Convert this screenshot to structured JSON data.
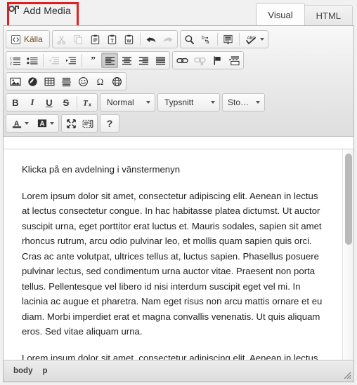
{
  "top_bar": {
    "add_media_label": "Add Media",
    "add_media_icon": "media-notes-icon",
    "highlight_color": "#e02020",
    "tabs": [
      {
        "label": "Visual",
        "active": true
      },
      {
        "label": "HTML",
        "active": false
      }
    ]
  },
  "toolbar": {
    "row1": {
      "source_button": {
        "label": "Källa",
        "icon": "source-code-icon"
      },
      "clipboard": [
        {
          "name": "cut-button",
          "icon": "scissors-icon",
          "disabled": true
        },
        {
          "name": "copy-button",
          "icon": "copy-icon",
          "disabled": true
        },
        {
          "name": "paste-button",
          "icon": "clipboard-icon",
          "disabled": false
        },
        {
          "name": "paste-as-plain-text-button",
          "icon": "clipboard-text-icon",
          "disabled": false
        },
        {
          "name": "paste-from-word-button",
          "icon": "clipboard-word-icon",
          "disabled": false
        },
        {
          "name": "undo-button",
          "icon": "undo-arrow-icon",
          "disabled": false
        },
        {
          "name": "redo-button",
          "icon": "redo-arrow-icon",
          "disabled": true
        }
      ],
      "editing": [
        {
          "name": "find-button",
          "icon": "magnifier-icon"
        },
        {
          "name": "replace-button",
          "icon": "replace-ba-icon"
        },
        {
          "name": "select-all-button",
          "icon": "select-all-icon"
        },
        {
          "name": "spellcheck-button",
          "icon": "abc-check-icon",
          "label": "ABC",
          "has_caret": true
        }
      ]
    },
    "row2": {
      "lists": [
        {
          "name": "numbered-list-button",
          "icon": "numbered-list-icon"
        },
        {
          "name": "bulleted-list-button",
          "icon": "bulleted-list-icon"
        },
        {
          "name": "decrease-indent-button",
          "icon": "outdent-icon",
          "disabled": true
        },
        {
          "name": "increase-indent-button",
          "icon": "indent-icon",
          "disabled": false
        },
        {
          "name": "blockquote-button",
          "icon": "quote-icon"
        },
        {
          "name": "align-left-button",
          "icon": "align-left-icon",
          "active": true
        },
        {
          "name": "align-center-button",
          "icon": "align-center-icon"
        },
        {
          "name": "align-right-button",
          "icon": "align-right-icon"
        },
        {
          "name": "align-justify-button",
          "icon": "align-justify-icon"
        }
      ],
      "links": [
        {
          "name": "insert-link-button",
          "icon": "link-icon"
        },
        {
          "name": "unlink-button",
          "icon": "unlink-icon",
          "disabled": true
        },
        {
          "name": "anchor-button",
          "icon": "flag-icon"
        },
        {
          "name": "page-break-button",
          "icon": "page-break-icon"
        }
      ]
    },
    "row3": {
      "insert": [
        {
          "name": "insert-image-button",
          "icon": "image-icon"
        },
        {
          "name": "insert-flash-button",
          "icon": "flash-icon"
        },
        {
          "name": "insert-table-button",
          "icon": "table-icon"
        },
        {
          "name": "horizontal-rule-button",
          "icon": "horizontal-rule-icon"
        },
        {
          "name": "insert-smiley-button",
          "icon": "smiley-icon"
        },
        {
          "name": "special-character-button",
          "icon": "omega-icon"
        },
        {
          "name": "iframe-button",
          "icon": "globe-icon"
        }
      ]
    },
    "row4": {
      "basic_styles": [
        {
          "name": "bold-button",
          "icon": "bold-icon",
          "label": "B"
        },
        {
          "name": "italic-button",
          "icon": "italic-icon",
          "label": "I"
        },
        {
          "name": "underline-button",
          "icon": "underline-icon",
          "label": "U"
        },
        {
          "name": "strikethrough-button",
          "icon": "strikethrough-icon",
          "label": "S"
        },
        {
          "name": "remove-format-button",
          "icon": "remove-format-icon",
          "label": "Tx"
        }
      ],
      "combos": [
        {
          "name": "paragraph-format-select",
          "value": "Normal"
        },
        {
          "name": "font-family-select",
          "value": "Typsnitt"
        },
        {
          "name": "font-size-select",
          "value": "Sto…"
        }
      ]
    },
    "row5": {
      "colors": [
        {
          "name": "text-color-button",
          "icon": "text-color-icon",
          "label": "A",
          "has_caret": true
        },
        {
          "name": "background-color-button",
          "icon": "background-color-icon",
          "label": "A",
          "has_caret": true
        }
      ],
      "tools": [
        {
          "name": "maximize-button",
          "icon": "maximize-icon"
        },
        {
          "name": "show-blocks-button",
          "icon": "show-blocks-icon"
        }
      ],
      "about": [
        {
          "name": "about-button",
          "icon": "question-mark-icon",
          "label": "?"
        }
      ]
    }
  },
  "content": {
    "paragraphs": [
      "Klicka på en avdelning i vänstermenyn",
      "Lorem ipsum dolor sit amet, consectetur adipiscing elit. Aenean in lectus at lectus consectetur congue. In hac habitasse platea dictumst. Ut auctor suscipit urna, eget porttitor erat luctus et. Mauris sodales, sapien sit amet rhoncus rutrum, arcu odio pulvinar leo, et mollis quam sapien quis orci. Cras ac ante volutpat, ultrices tellus at, luctus sapien. Phasellus posuere pulvinar lectus, sed condimentum urna auctor vitae. Praesent non porta tellus. Pellentesque vel libero id nisi interdum suscipit eget vel mi. In lacinia ac augue et pharetra. Nam eget risus non arcu mattis ornare et eu diam. Morbi imperdiet erat et magna convallis venenatis. Ut quis aliquam eros. Sed vitae aliquam urna.",
      "Lorem ipsum dolor sit amet, consectetur adipiscing elit. Aenean in lectus at"
    ]
  },
  "statusbar": {
    "elements_path": [
      "body",
      "p"
    ]
  }
}
